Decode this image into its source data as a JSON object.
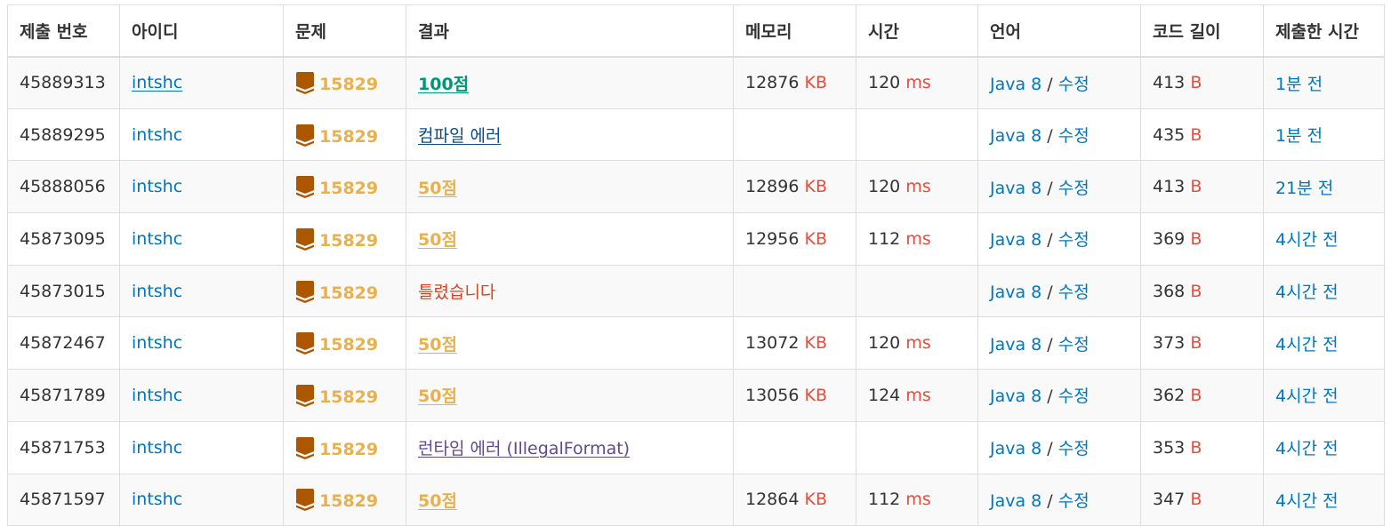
{
  "headers": [
    "제출 번호",
    "아이디",
    "문제",
    "결과",
    "메모리",
    "시간",
    "언어",
    "코드 길이",
    "제출한 시간"
  ],
  "units": {
    "memory": "KB",
    "time": "ms",
    "length": "B"
  },
  "lang_separator": " / ",
  "colors": {
    "link": "#0076c0",
    "unit": "#e74c3c",
    "problem_gold": "#e8b14e",
    "accepted": "#009874",
    "partial": "#e8b14e",
    "compile_error": "#0f4c81",
    "wrong": "#dd4124",
    "runtime_error": "#5f4b8b",
    "tier_badge": "#ad5600"
  },
  "tier_icon": "bronze-2-tier-icon",
  "rows": [
    {
      "id": "45889313",
      "user": "intshc",
      "tier": "2",
      "problem": "15829",
      "result": "100점",
      "result_type": "ac",
      "memory": "12876",
      "time": "120",
      "lang": "Java 8",
      "edit": "수정",
      "length": "413",
      "submitted": "1분 전"
    },
    {
      "id": "45889295",
      "user": "intshc",
      "tier": "2",
      "problem": "15829",
      "result": "컴파일 에러",
      "result_type": "ce",
      "memory": "",
      "time": "",
      "lang": "Java 8",
      "edit": "수정",
      "length": "435",
      "submitted": "1분 전"
    },
    {
      "id": "45888056",
      "user": "intshc",
      "tier": "2",
      "problem": "15829",
      "result": "50점",
      "result_type": "pac",
      "memory": "12896",
      "time": "120",
      "lang": "Java 8",
      "edit": "수정",
      "length": "413",
      "submitted": "21분 전"
    },
    {
      "id": "45873095",
      "user": "intshc",
      "tier": "2",
      "problem": "15829",
      "result": "50점",
      "result_type": "pac",
      "memory": "12956",
      "time": "112",
      "lang": "Java 8",
      "edit": "수정",
      "length": "369",
      "submitted": "4시간 전"
    },
    {
      "id": "45873015",
      "user": "intshc",
      "tier": "2",
      "problem": "15829",
      "result": "틀렸습니다",
      "result_type": "wa",
      "memory": "",
      "time": "",
      "lang": "Java 8",
      "edit": "수정",
      "length": "368",
      "submitted": "4시간 전"
    },
    {
      "id": "45872467",
      "user": "intshc",
      "tier": "2",
      "problem": "15829",
      "result": "50점",
      "result_type": "pac",
      "memory": "13072",
      "time": "120",
      "lang": "Java 8",
      "edit": "수정",
      "length": "373",
      "submitted": "4시간 전"
    },
    {
      "id": "45871789",
      "user": "intshc",
      "tier": "2",
      "problem": "15829",
      "result": "50점",
      "result_type": "pac",
      "memory": "13056",
      "time": "124",
      "lang": "Java 8",
      "edit": "수정",
      "length": "362",
      "submitted": "4시간 전"
    },
    {
      "id": "45871753",
      "user": "intshc",
      "tier": "2",
      "problem": "15829",
      "result": "런타임 에러 (IllegalFormat)",
      "result_type": "rte",
      "memory": "",
      "time": "",
      "lang": "Java 8",
      "edit": "수정",
      "length": "353",
      "submitted": "4시간 전"
    },
    {
      "id": "45871597",
      "user": "intshc",
      "tier": "2",
      "problem": "15829",
      "result": "50점",
      "result_type": "pac",
      "memory": "12864",
      "time": "112",
      "lang": "Java 8",
      "edit": "수정",
      "length": "347",
      "submitted": "4시간 전"
    }
  ]
}
